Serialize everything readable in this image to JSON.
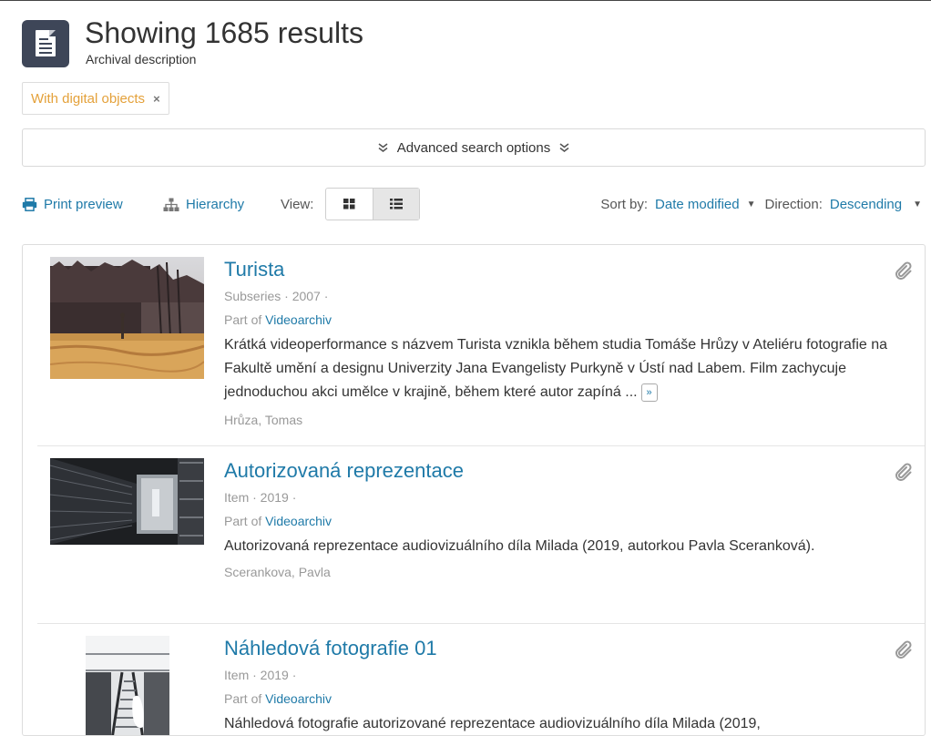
{
  "header": {
    "icon": "document-icon",
    "title": "Showing 1685 results",
    "subtitle": "Archival description"
  },
  "filter": {
    "label": "With digital objects",
    "remove_icon": "×"
  },
  "advanced_search": {
    "label": "Advanced search options",
    "chevron": "»"
  },
  "toolbar": {
    "print_preview": "Print preview",
    "hierarchy": "Hierarchy",
    "view_label": "View:",
    "view_modes": [
      "card-view-icon",
      "table-view-icon"
    ],
    "active_view": "table-view-icon",
    "sort_label": "Sort by:",
    "sort_value": "Date modified",
    "direction_label": "Direction:",
    "direction_value": "Descending"
  },
  "results": [
    {
      "title": "Turista",
      "level": "Subseries",
      "date": "2007",
      "meta": "Subseries · 2007 ·",
      "part_of_label": "Part of",
      "part_of": "Videoarchiv",
      "description": "Krátká videoperformance s názvem Turista vznikla během studia Tomáše Hrůzy v Ateliéru fotografie na Fakultě umění a designu Univerzity Jana Evangelisty Purkyně v Ústí nad Labem. Film zachycuje jednoduchou akci umělce v krajině, během které autor zapíná ...",
      "more": "»",
      "creator": "Hrůza, Tomas",
      "icon": "paperclip-icon"
    },
    {
      "title": "Autorizovaná reprezentace",
      "level": "Item",
      "date": "2019",
      "meta": "Item · 2019 ·",
      "part_of_label": "Part of",
      "part_of": "Videoarchiv",
      "description": "Autorizovaná reprezentace audiovizuálního díla Milada (2019, autorkou Pavla Sceranková).",
      "creator": "Scerankova, Pavla",
      "icon": "paperclip-icon"
    },
    {
      "title": "Náhledová fotografie 01",
      "level": "Item",
      "date": "2019",
      "meta": "Item · 2019 ·",
      "part_of_label": "Part of",
      "part_of": "Videoarchiv",
      "description": "Náhledová fotografie autorizované reprezentace audiovizuálního díla Milada (2019,",
      "icon": "paperclip-icon"
    }
  ],
  "colors": {
    "link": "#1f7aa8",
    "filter_tag": "#e4a13a",
    "header_icon_bg": "#3e4658"
  }
}
